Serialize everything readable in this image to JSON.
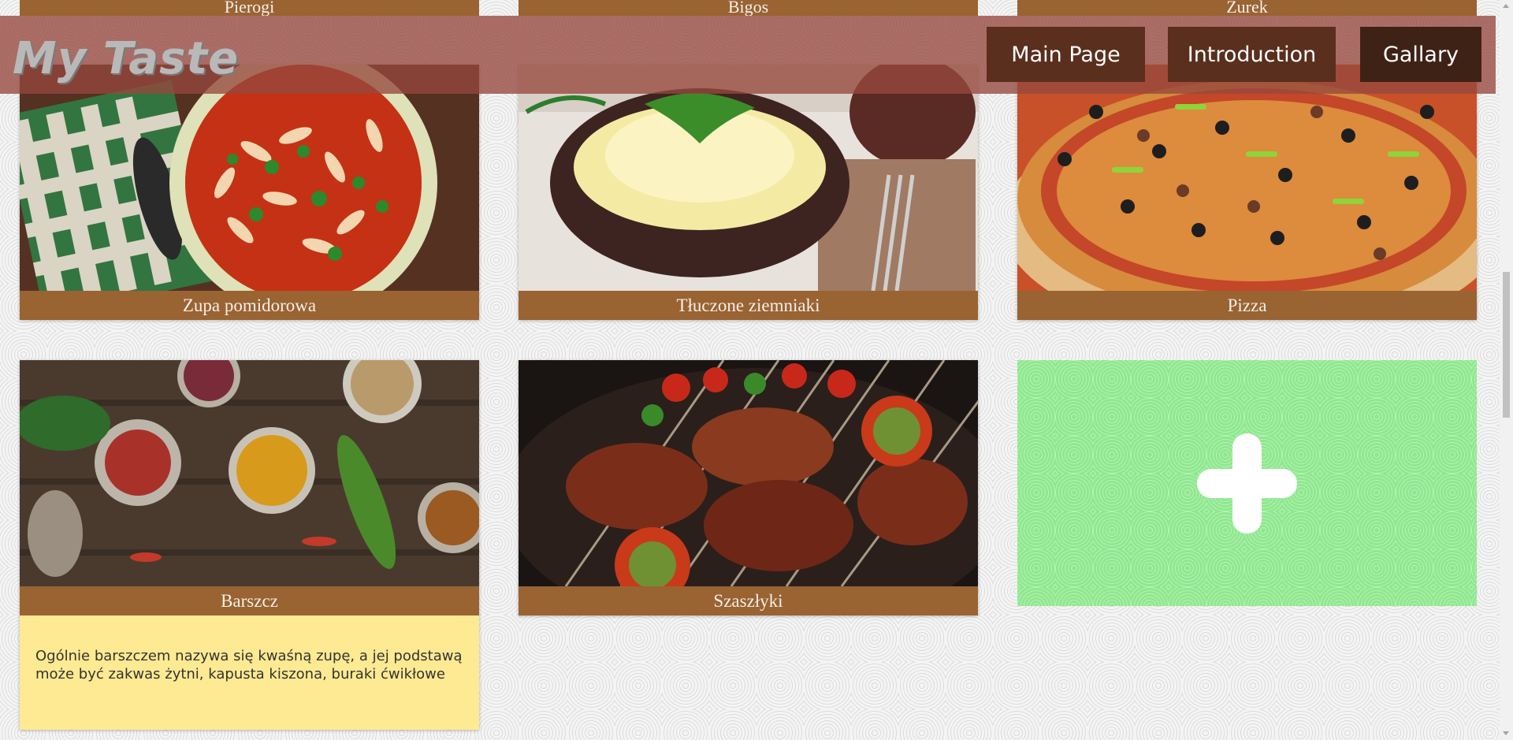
{
  "header": {
    "logo": "My Taste",
    "nav": [
      "Main Page",
      "Introduction",
      "Gallary"
    ]
  },
  "top_row": [
    "Pierogi",
    "Bigos",
    "Żurek"
  ],
  "cards": [
    {
      "title": "Zupa pomidorowa"
    },
    {
      "title": "Tłuczone ziemniaki"
    },
    {
      "title": "Pizza"
    },
    {
      "title": "Barszcz",
      "description": "Ogólnie barszczem nazywa się kwaśną zupę, a jej podstawą może być zakwas żytni, kapusta kiszona, buraki ćwikłowe"
    },
    {
      "title": "Szaszłyki"
    }
  ],
  "colors": {
    "caption": "#9a6332",
    "header": "#96483e",
    "add_card": "#8fe88f",
    "description_bg": "#feea92"
  },
  "icons": {
    "add": "plus-icon"
  }
}
